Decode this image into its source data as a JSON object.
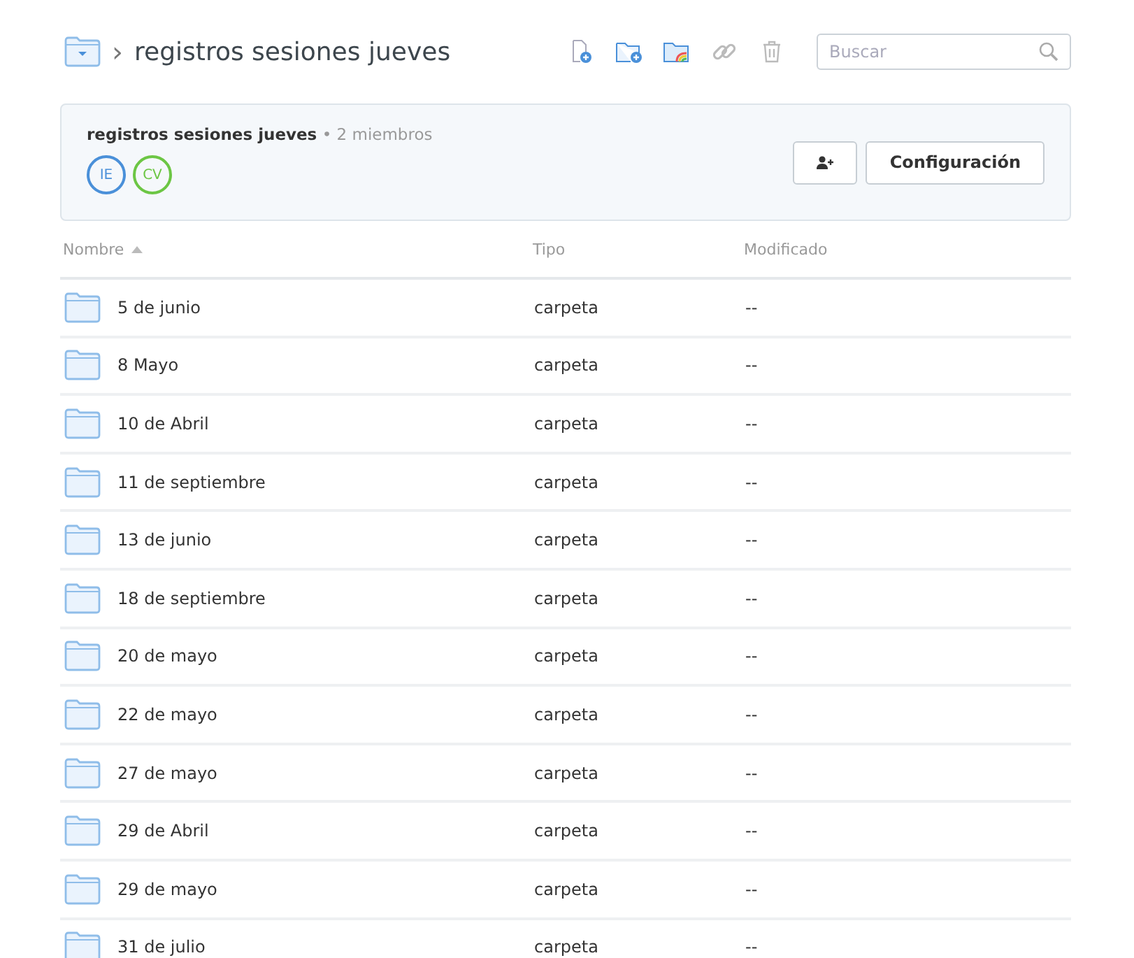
{
  "breadcrumb": {
    "separator": "›",
    "title": "registros sesiones jueves"
  },
  "search": {
    "placeholder": "Buscar"
  },
  "share_panel": {
    "name": "registros sesiones jueves",
    "separator": "•",
    "members_count": "2 miembros",
    "members": [
      {
        "initials": "IE",
        "color": "#4a90d9"
      },
      {
        "initials": "CV",
        "color": "#6cc644"
      }
    ],
    "settings_button": "Configuración"
  },
  "table": {
    "columns": [
      "Nombre",
      "Tipo",
      "Modificado"
    ],
    "rows": [
      {
        "name": "5 de junio",
        "type": "carpeta",
        "modified": "--"
      },
      {
        "name": "8 Mayo",
        "type": "carpeta",
        "modified": "--"
      },
      {
        "name": "10 de Abril",
        "type": "carpeta",
        "modified": "--"
      },
      {
        "name": "11 de septiembre",
        "type": "carpeta",
        "modified": "--"
      },
      {
        "name": "13 de junio",
        "type": "carpeta",
        "modified": "--"
      },
      {
        "name": "18 de septiembre",
        "type": "carpeta",
        "modified": "--"
      },
      {
        "name": "20 de mayo",
        "type": "carpeta",
        "modified": "--"
      },
      {
        "name": "22 de mayo",
        "type": "carpeta",
        "modified": "--"
      },
      {
        "name": "27 de mayo",
        "type": "carpeta",
        "modified": "--"
      },
      {
        "name": "29 de Abril",
        "type": "carpeta",
        "modified": "--"
      },
      {
        "name": "29 de mayo",
        "type": "carpeta",
        "modified": "--"
      },
      {
        "name": "31 de julio",
        "type": "carpeta",
        "modified": "--"
      }
    ]
  }
}
